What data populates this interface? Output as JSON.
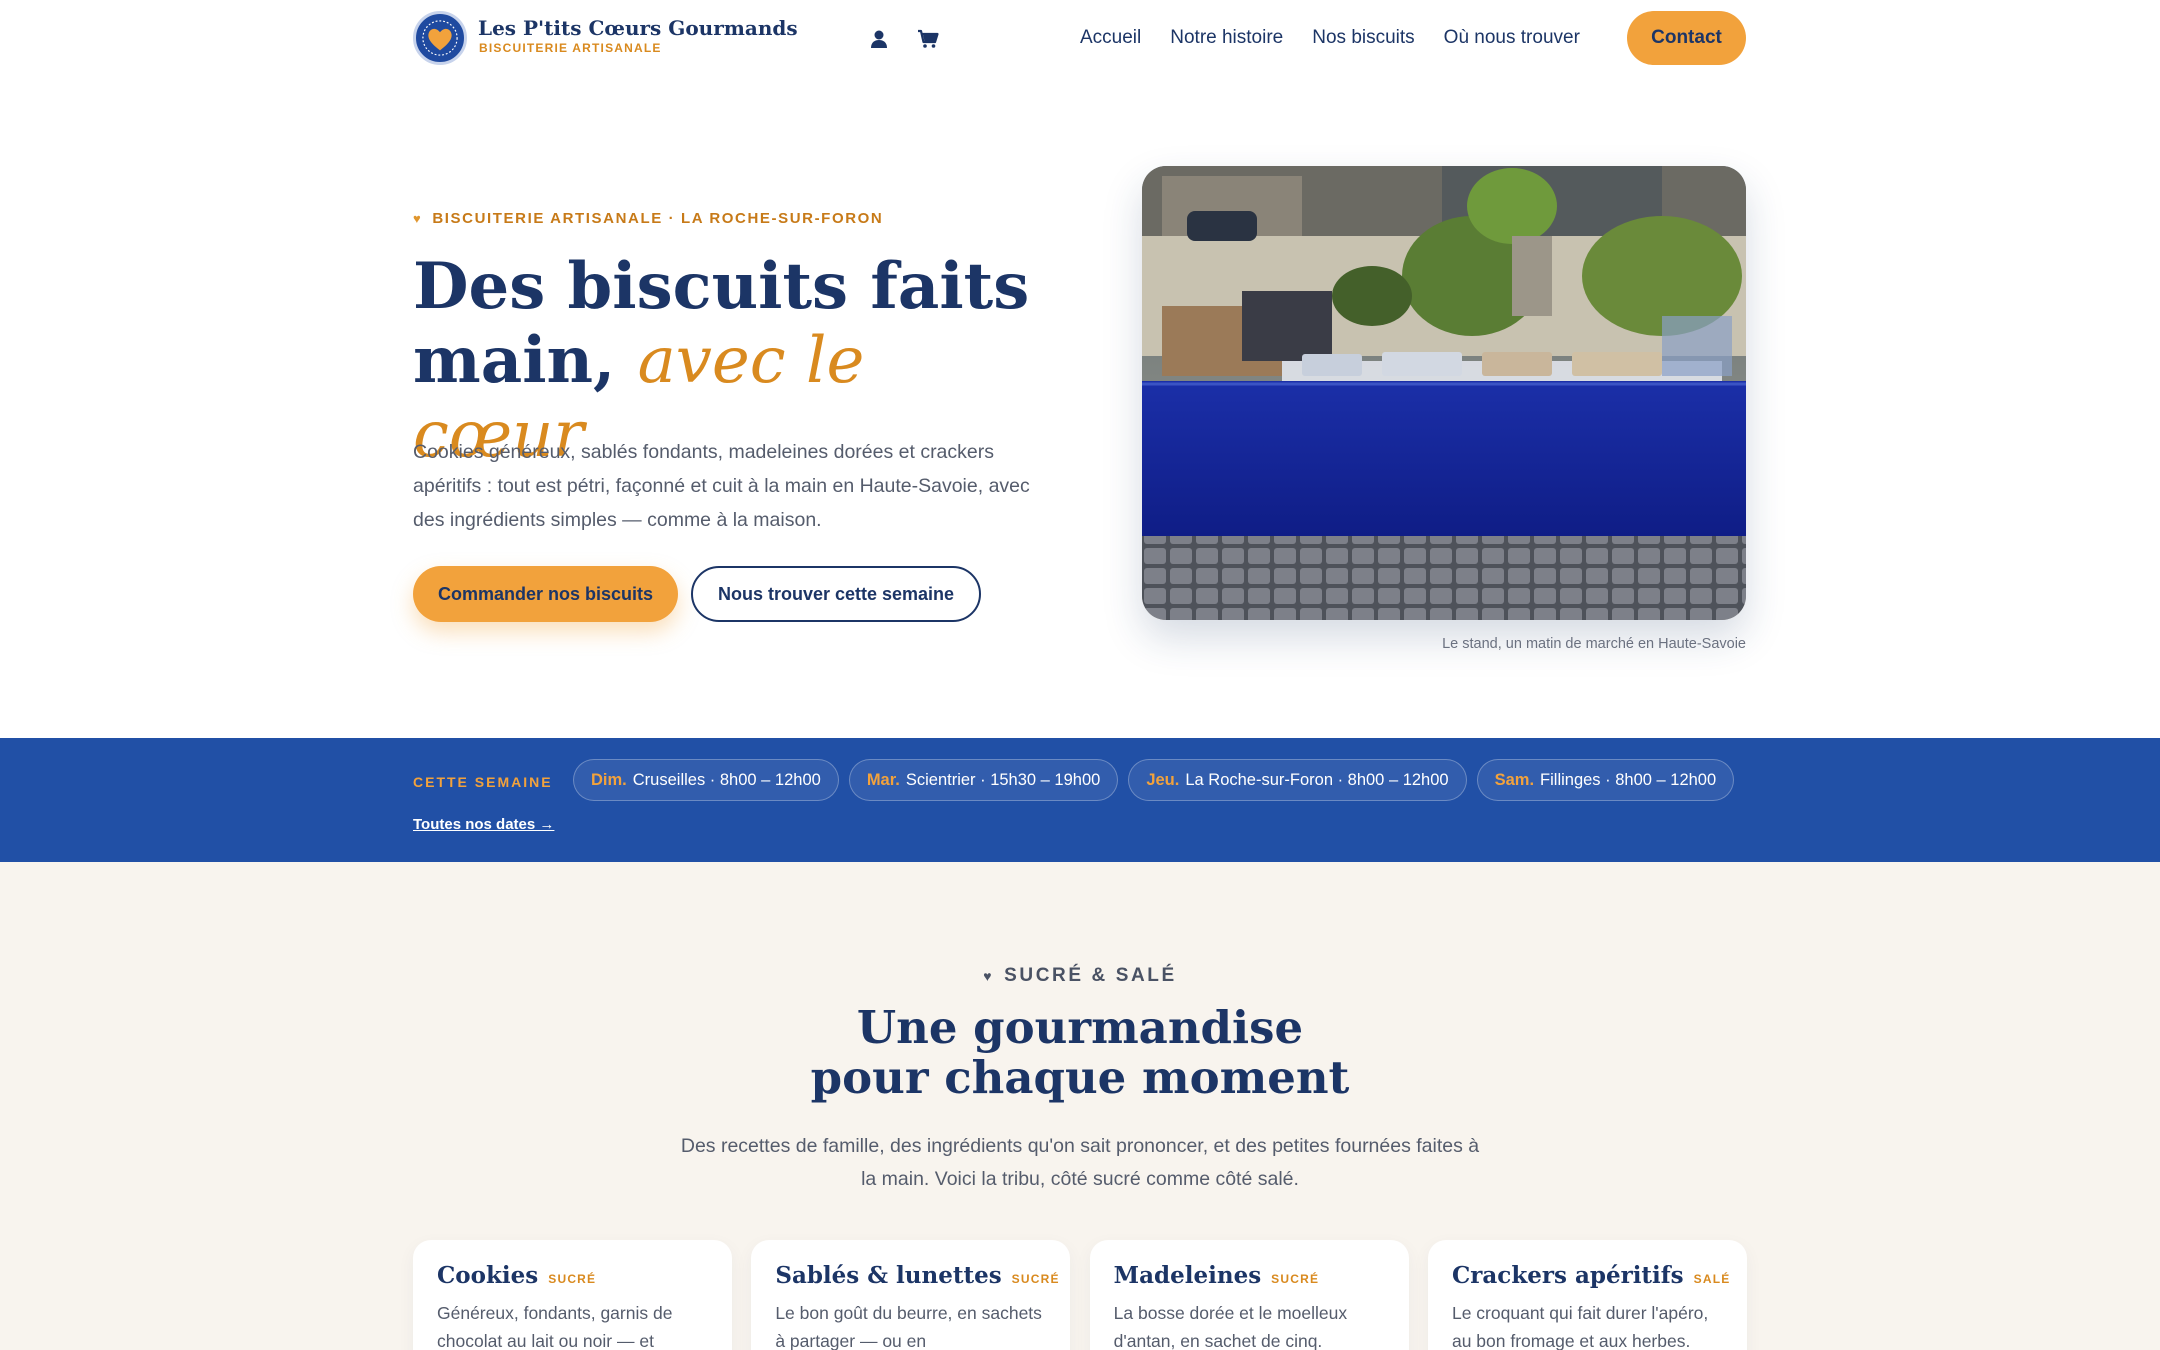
{
  "header": {
    "brand_name": "Les P'tits Cœurs Gourmands",
    "brand_tagline": "BISCUITERIE ARTISANALE",
    "logo_text": "Les P'tits Cœurs Gourmands",
    "icons": {
      "account": "user-icon",
      "cart": "cart-icon"
    },
    "nav": [
      {
        "label": "Accueil"
      },
      {
        "label": "Notre histoire"
      },
      {
        "label": "Nos biscuits"
      },
      {
        "label": "Où nous trouver"
      }
    ],
    "contact_label": "Contact"
  },
  "hero": {
    "eyebrow": "BISCUITERIE ARTISANALE · LA ROCHE-SUR-FORON",
    "title_main": "Des biscuits faits main,",
    "title_accent": "avec le cœur",
    "lead": "Cookies généreux, sablés fondants, madeleines dorées et crackers apéritifs : tout est pétri, façonné et cuit à la main en Haute-Savoie, avec des ingrédients simples — comme à la maison.",
    "primary_cta": "Commander nos biscuits",
    "secondary_cta": "Nous trouver cette semaine",
    "photo_caption": "Le stand, un matin de marché en Haute-Savoie"
  },
  "week": {
    "label": "CETTE SEMAINE",
    "markets": [
      {
        "day": "Dim.",
        "place": "Cruseilles · 8h00 – 12h00"
      },
      {
        "day": "Mar.",
        "place": "Scientrier · 15h30 – 19h00"
      },
      {
        "day": "Jeu.",
        "place": "La Roche-sur-Foron · 8h00 – 12h00"
      },
      {
        "day": "Sam.",
        "place": "Fillinges · 8h00 – 12h00"
      }
    ],
    "all_dates": "Toutes nos dates →"
  },
  "products": {
    "eyebrow": "SUCRÉ & SALÉ",
    "title_line1": "Une gourmandise",
    "title_line2": "pour chaque moment",
    "lead": "Des recettes de famille, des ingrédients qu'on sait prononcer, et des petites fournées faites à la main. Voici la tribu, côté sucré comme côté salé.",
    "cards": [
      {
        "title": "Cookies",
        "tag": "SUCRÉ",
        "text": "Généreux, fondants, garnis de chocolat au lait ou noir — et"
      },
      {
        "title": "Sablés & lunettes",
        "tag": "SUCRÉ",
        "text": "Le bon goût du beurre, en sachets à partager — ou en"
      },
      {
        "title": "Madeleines",
        "tag": "SUCRÉ",
        "text": "La bosse dorée et le moelleux d'antan, en sachet de cinq."
      },
      {
        "title": "Crackers apéritifs",
        "tag": "SALÉ",
        "text": "Le croquant qui fait durer l'apéro, au bon fromage et aux herbes."
      }
    ]
  },
  "colors": {
    "navy": "#1c3566",
    "accent_orange": "#f2a23c",
    "strip_blue": "#2150a6",
    "section_bg": "#f8f4ee"
  }
}
